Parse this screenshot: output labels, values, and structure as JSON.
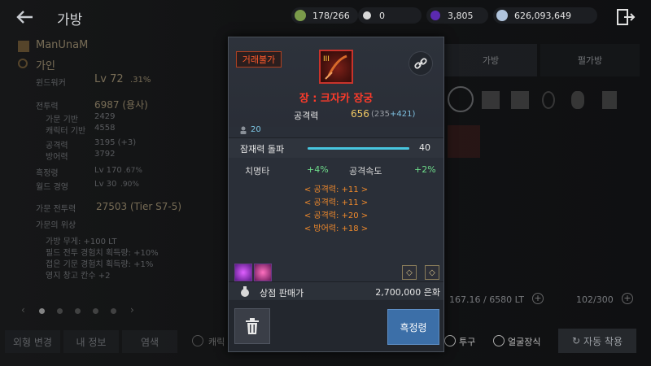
{
  "header": {
    "title": "가방"
  },
  "currencies": [
    {
      "icon": "stamina-icon",
      "value": "178/266",
      "color": "#7a9a4a"
    },
    {
      "icon": "pearl-icon",
      "value": "0",
      "color": "#d8d8d8"
    },
    {
      "icon": "black-gem-icon",
      "value": "3,805",
      "color": "#7a3ad0"
    },
    {
      "icon": "silver-coin-icon",
      "value": "626,093,649",
      "color": "#b0c4dc"
    }
  ],
  "character": {
    "name": "ManUnaM",
    "family": "가인",
    "class": "윈드워커",
    "level": "Lv 72",
    "level_pct": ".31%",
    "combat_power_label": "전투력",
    "combat_power": "6987 (용사)",
    "base_label": "가문 기반",
    "base_val": "2429",
    "char_base_label": "캐릭터 기반",
    "char_base_val": "4558",
    "atk_label": "공격력",
    "atk_val": "3195 (+3)",
    "def_label": "방어력",
    "def_val": "3792",
    "black_spirit_label": "흑정령",
    "black_spirit_val": "Lv 170",
    "black_spirit_pct": ".67%",
    "world_label": "월드 경영",
    "world_val": "Lv 30",
    "world_pct": ".90%",
    "family_power_label": "가문 전투력",
    "family_power": "27503 (Tier S7-5)",
    "prestige_label": "가문의 위상",
    "prestige_items": [
      "가방 무게: +100 LT",
      "필드 전투 경험치 획득량: +10%",
      "접은 기문 경험치 획득량: +1%",
      "영지 창고 칸수 +2"
    ]
  },
  "bottom": {
    "appearance": "외형 변경",
    "my_info": "내 정보",
    "dye": "염색",
    "character_cb": "캐릭",
    "helmet": "투구",
    "face": "얼굴장식",
    "auto_equip": "자동 착용"
  },
  "right_panel": {
    "tab_bag": "가방",
    "tab_pearl": "펄가방",
    "weight": "167.16 / 6580 LT",
    "slots": "102/300"
  },
  "tooltip": {
    "badge": "거래불가",
    "item_name": "장 : 크자카 장궁",
    "attack_label": "공격력",
    "attack_value": "656",
    "attack_base": "(235",
    "attack_bonus": "+421)",
    "level_req": "20",
    "potential_label": "잠재력 돌파",
    "potential_value": "40",
    "potential_fill": 1.0,
    "crit_label": "치명타",
    "crit_value": "+4%",
    "atk_speed_label": "공격속도",
    "atk_speed_value": "+2%",
    "options": [
      "< 공격력: +11 >",
      "< 공격력: +11 >",
      "< 공격력: +20 >",
      "< 방어력: +18 >"
    ],
    "price_label": "상점 판매가",
    "price_value": "2,700,000 은화",
    "enhance_label": "흑정령"
  }
}
